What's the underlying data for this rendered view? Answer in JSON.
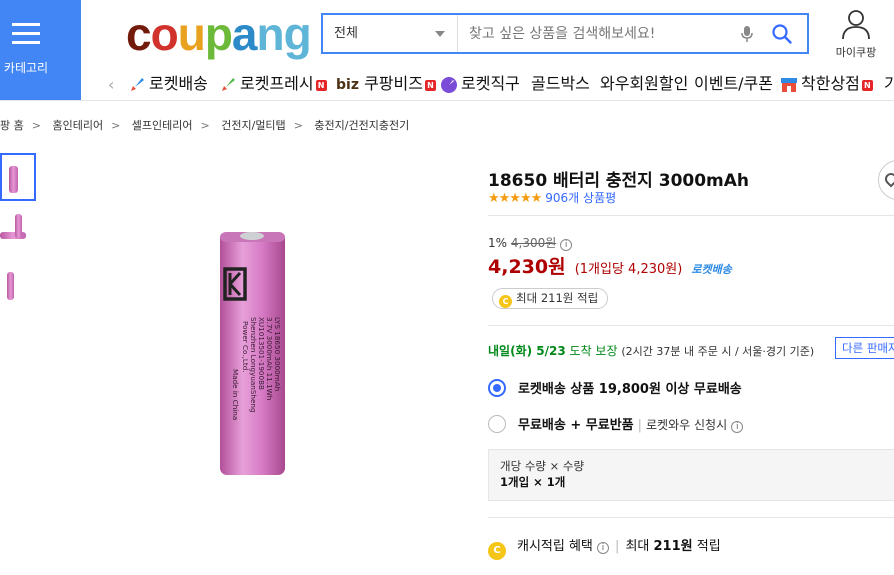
{
  "header": {
    "category_label": "카테고리",
    "logo_parts": [
      "c",
      "o",
      "u",
      "p",
      "a",
      "ng"
    ],
    "search": {
      "category_value": "전체",
      "placeholder": "찾고 싶은 상품을 검색해보세요!"
    },
    "mypage_label": "마이쿠팡"
  },
  "nav": {
    "items": [
      {
        "label": "로켓배송",
        "icon": "rocket-icon",
        "badge": ""
      },
      {
        "label": "로켓프레시",
        "icon": "rocket-fresh-icon",
        "badge": "N"
      },
      {
        "label": "쿠팡비즈",
        "icon": "biz-icon",
        "prefix": "biz",
        "badge": "N"
      },
      {
        "label": "로켓직구",
        "icon": "rocket-global-icon",
        "badge": ""
      },
      {
        "label": "골드박스",
        "icon": "",
        "badge": ""
      },
      {
        "label": "와우회원할인",
        "icon": "",
        "badge": ""
      },
      {
        "label": "이벤트/쿠폰",
        "icon": "",
        "badge": ""
      },
      {
        "label": "착한상점",
        "icon": "store-icon",
        "badge": "N"
      },
      {
        "label": "기",
        "icon": "",
        "badge": ""
      }
    ]
  },
  "breadcrumb": [
    "팡 홈",
    "홈인테리어",
    "셀프인테리어",
    "건전지/멀티탭",
    "충전지/건전지충전기"
  ],
  "product": {
    "title": "18650 배터리 충전지 3000mAh",
    "rating": 4.5,
    "stars": "★★★★★",
    "review_count": "906개 상품평",
    "discount_rate": "1%",
    "original_price": "4,300원",
    "price": "4,230원",
    "unit_price": "(1개입당 4,230원)",
    "rocket_label": "로켓배송",
    "cash_max": "최대 211원 적립",
    "image_text": {
      "line1": "LYS 18650 3000mAh",
      "line2": "3.7V 3000mAh 11.1Wh",
      "line3": "XU1013501-1900BB",
      "line4": "Shenzhen LongyuanSheng",
      "line5": "Power Co.,Ltd.",
      "line6": "Made in China"
    }
  },
  "delivery": {
    "date": "내일(화) 5/23",
    "guarantee": "도착 보장",
    "detail": "(2시간 37분  내 주문 시 / 서울·경기 기준)",
    "other_sellers": "다른 판매자"
  },
  "shipping_options": [
    {
      "label": "로켓배송 상품 19,800원 이상 무료배송",
      "selected": true,
      "extra": ""
    },
    {
      "label": "무료배송 + 무료반품",
      "selected": false,
      "extra": "로켓와우 신청시"
    }
  ],
  "quantity_box": {
    "header": "개당 수량 × 수량",
    "value": "1개입 × 1개"
  },
  "cashback": {
    "label": "캐시적립 혜택",
    "amount_prefix": "최대",
    "amount": "211원",
    "amount_suffix": "적립"
  },
  "colors": {
    "accent": "#346aff",
    "price_red": "#ae0000",
    "category_blue": "#4285f4",
    "delivery_green": "#00891a"
  }
}
